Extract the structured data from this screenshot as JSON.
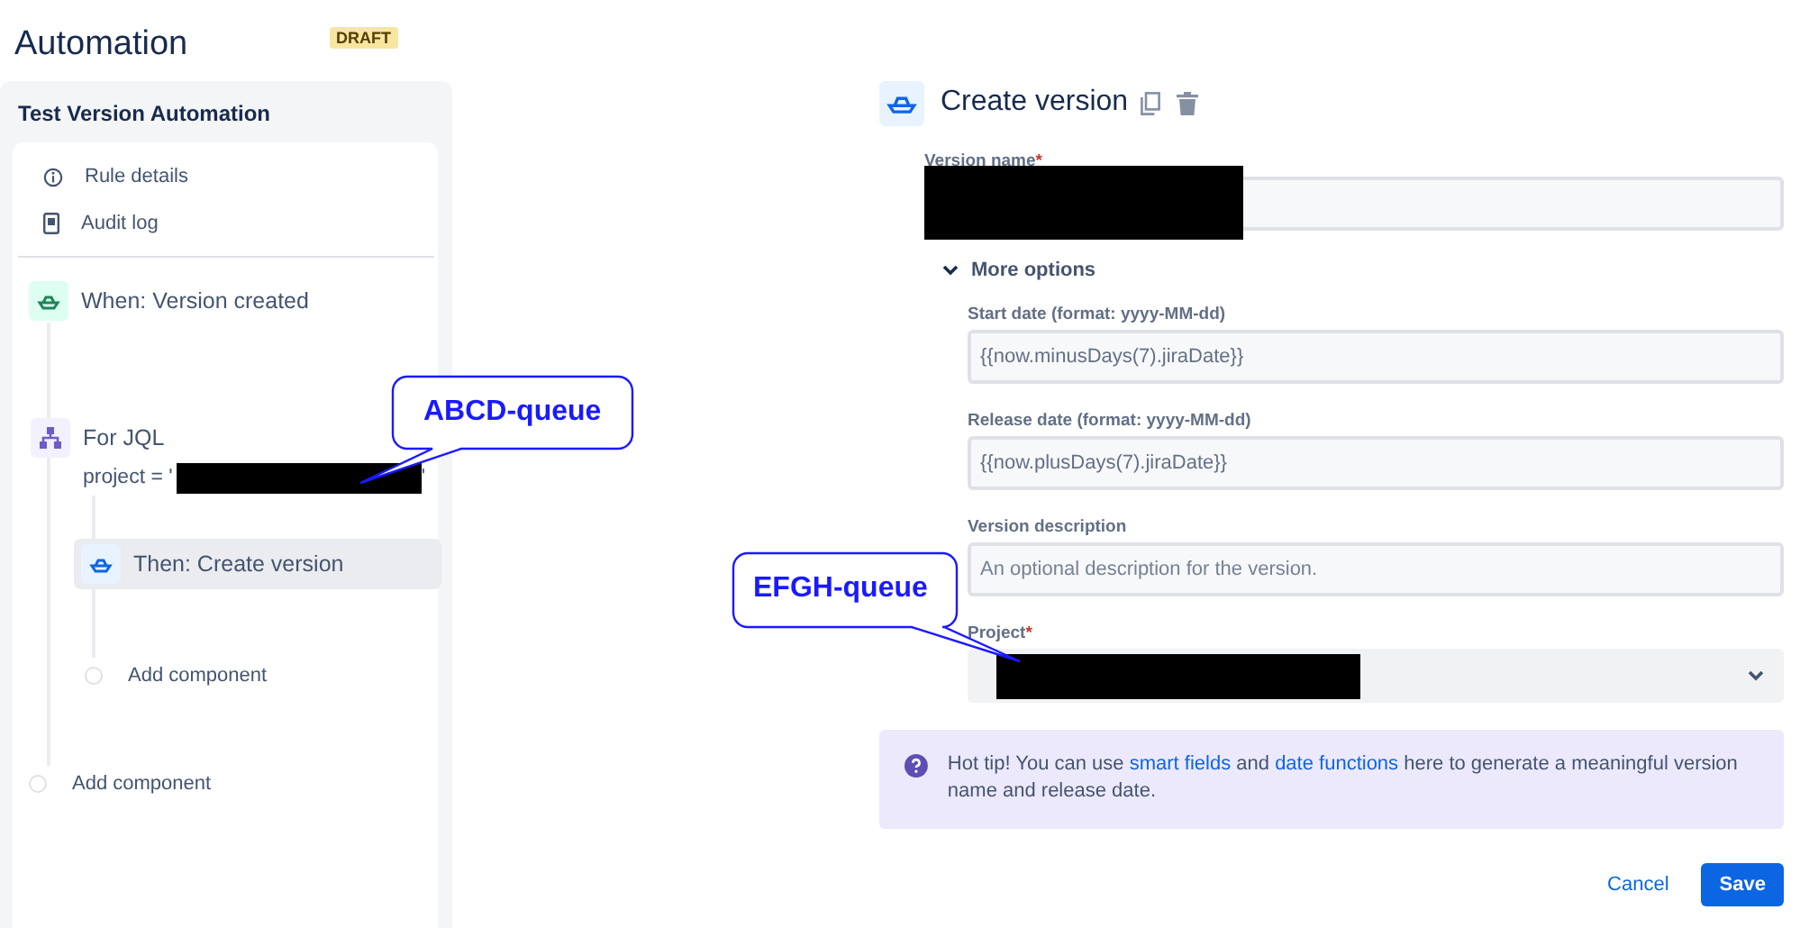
{
  "header": {
    "title": "Automation",
    "badge": "DRAFT"
  },
  "rule": {
    "name": "Test Version Automation",
    "menu": [
      {
        "kind": "info",
        "label": "Rule details"
      },
      {
        "kind": "log",
        "label": "Audit log"
      }
    ],
    "trigger": {
      "label": "When: Version created"
    },
    "branch": {
      "label": "For JQL",
      "jql_prefix": "project = '",
      "jql_suffix": "'",
      "action": {
        "label": "Then: Create version",
        "selected": true
      },
      "add_label": "Add component"
    },
    "add_label": "Add component"
  },
  "panel": {
    "title": "Create version",
    "version_name": {
      "label": "Version name",
      "required_mark": "*"
    },
    "more_options": {
      "label": "More options",
      "expanded": true
    },
    "fields": [
      {
        "label": "Start date (format: yyyy-MM-dd)",
        "value": "{{now.minusDays(7).jiraDate}}"
      },
      {
        "label": "Release date (format: yyyy-MM-dd)",
        "value": "{{now.plusDays(7).jiraDate}}"
      },
      {
        "label": "Version description",
        "placeholder": "An optional description for the version."
      }
    ],
    "project": {
      "label": "Project",
      "required_mark": "*"
    },
    "tip": [
      {
        "kind": "text",
        "text": "Hot tip! You can use "
      },
      {
        "kind": "link",
        "text": "smart fields"
      },
      {
        "kind": "text",
        "text": " and "
      },
      {
        "kind": "link",
        "text": "date functions"
      },
      {
        "kind": "text",
        "text": " here to generate a meaningful version name and release date."
      }
    ],
    "buttons": [
      {
        "kind": "subtle",
        "label": "Cancel"
      },
      {
        "kind": "primary",
        "label": "Save"
      }
    ]
  },
  "callouts": [
    {
      "text": "ABCD-queue"
    },
    {
      "text": "EFGH-queue"
    }
  ]
}
